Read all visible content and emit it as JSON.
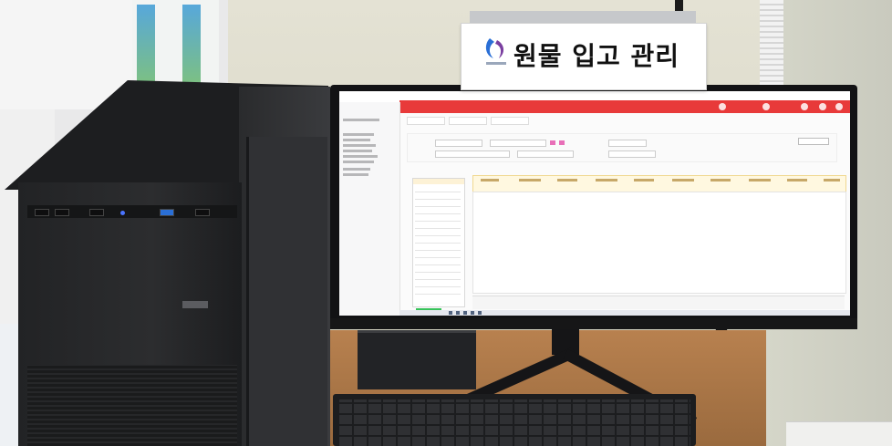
{
  "sign": {
    "title": "원물 입고 관리"
  },
  "colors": {
    "app_header": "#e83a3a",
    "sign_logo_blue": "#2a6fd6",
    "sign_logo_purple": "#7a3fa0",
    "confirm_button": "#36c35a"
  }
}
